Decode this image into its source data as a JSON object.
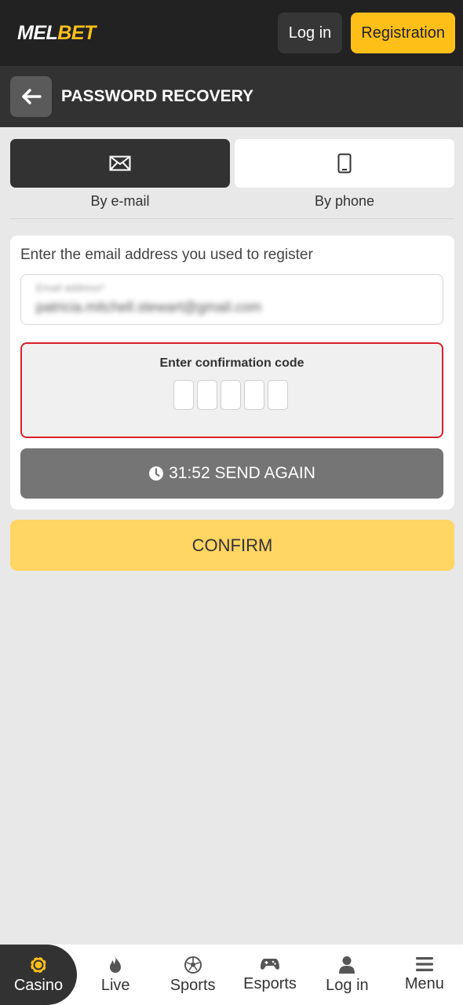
{
  "header": {
    "logo_main": "MEL",
    "logo_accent": "BET",
    "login_label": "Log in",
    "registration_label": "Registration"
  },
  "subheader": {
    "title": "PASSWORD RECOVERY"
  },
  "tabs": [
    {
      "label": "By e-mail",
      "icon": "envelope-icon",
      "active": true
    },
    {
      "label": "By phone",
      "icon": "phone-icon",
      "active": false
    }
  ],
  "form": {
    "prompt": "Enter the email address you used to register",
    "email_label": "Email address*",
    "email_value": "patricia.mitchell.stewart@gmail.com",
    "code_title": "Enter confirmation code",
    "code_cells": [
      "",
      "",
      "",
      "",
      ""
    ],
    "send_again_label": "31:52 SEND AGAIN",
    "confirm_label": "CONFIRM"
  },
  "bottom_nav": [
    {
      "label": "Casino",
      "icon": "casino-chip-icon",
      "active": true
    },
    {
      "label": "Live",
      "icon": "flame-icon",
      "active": false
    },
    {
      "label": "Sports",
      "icon": "soccer-ball-icon",
      "active": false
    },
    {
      "label": "Esports",
      "icon": "gamepad-icon",
      "active": false
    },
    {
      "label": "Log in",
      "icon": "user-icon",
      "active": false
    },
    {
      "label": "Menu",
      "icon": "hamburger-menu-icon",
      "active": false
    }
  ],
  "colors": {
    "brand_yellow": "#ffbf19",
    "confirm_yellow": "#ffd563",
    "dark": "#222222",
    "error_red": "#d9212b"
  }
}
